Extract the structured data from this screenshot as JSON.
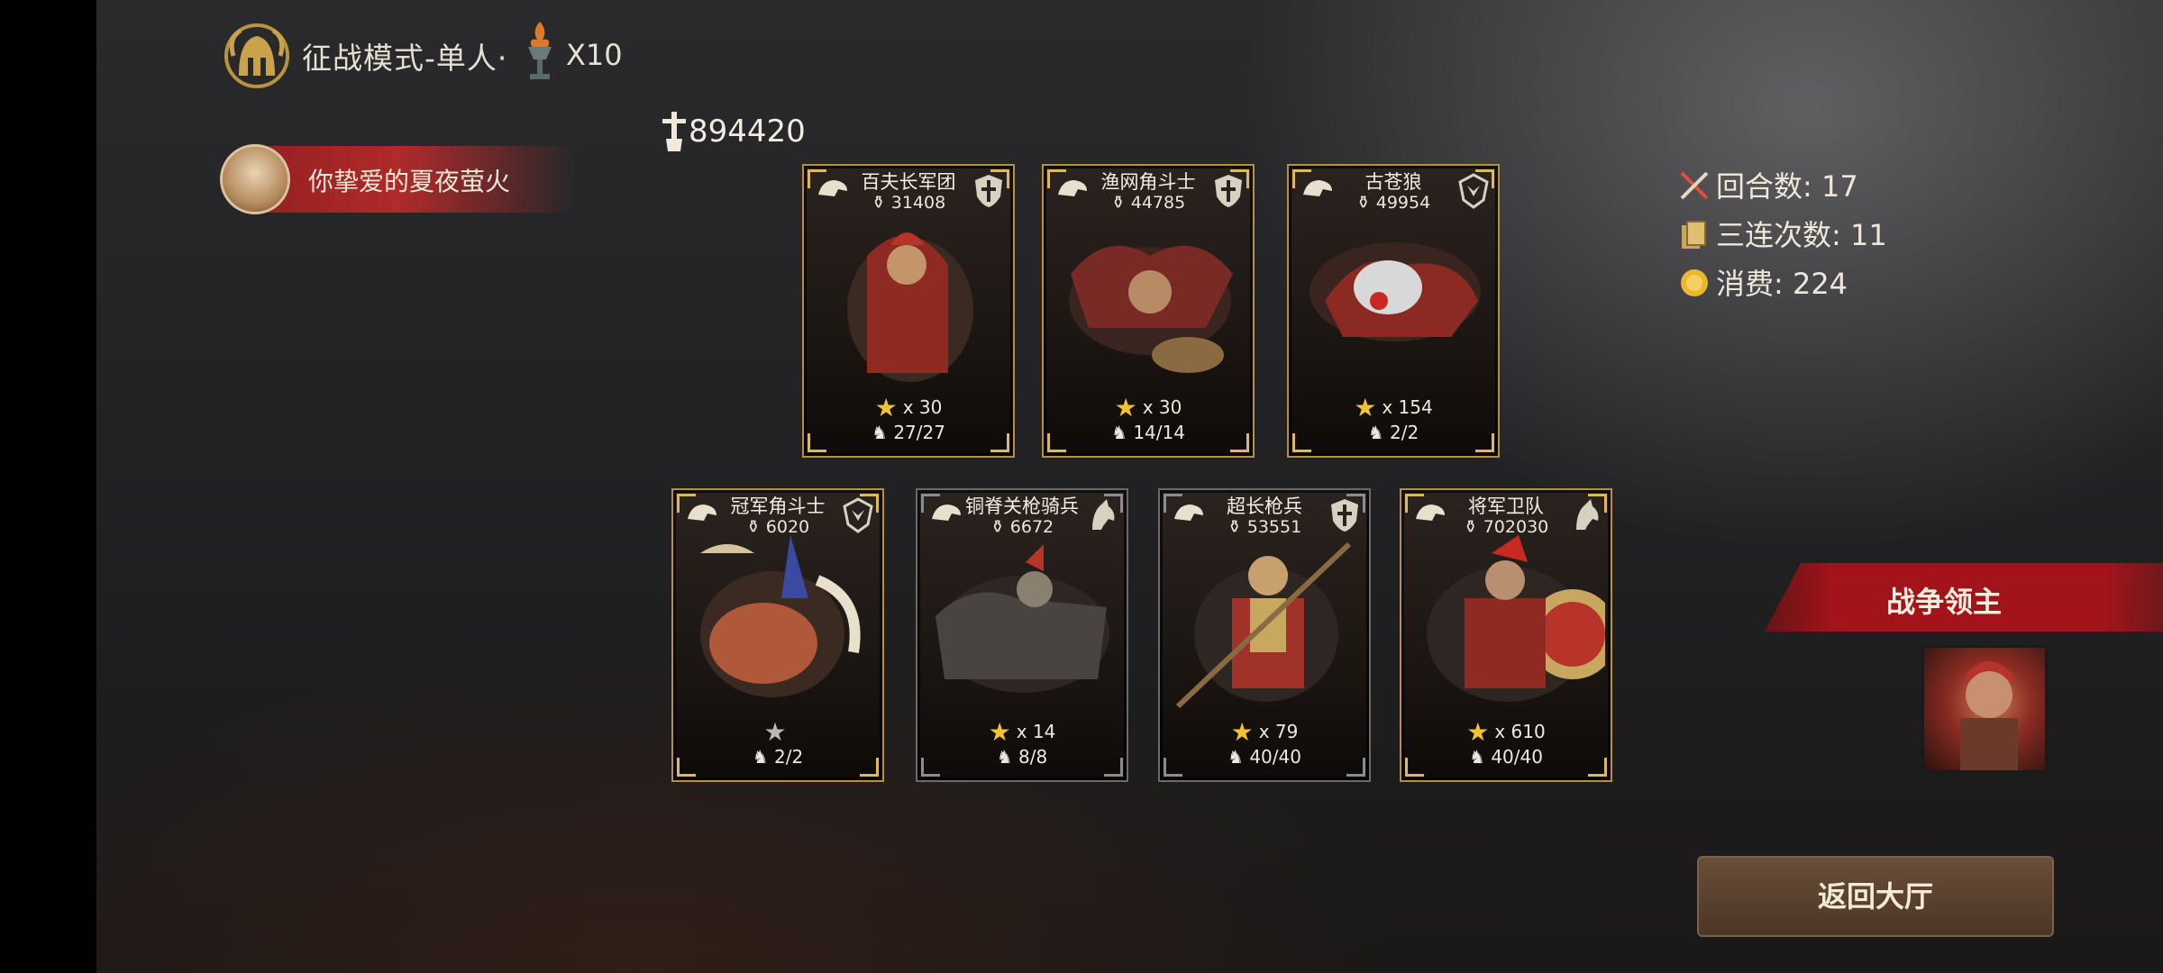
{
  "header": {
    "mode_title": "征战模式-单人·",
    "multiplier": "X10"
  },
  "player": {
    "name": "你挚爱的夏夜萤火"
  },
  "total_power": "894420",
  "cards_top": [
    {
      "name": "百夫长军团",
      "power": "31408",
      "stars": "x 30",
      "count": "27/27",
      "frame": "gold",
      "type_icon": "shield-icon"
    },
    {
      "name": "渔网角斗士",
      "power": "44785",
      "stars": "x 30",
      "count": "14/14",
      "frame": "gold",
      "type_icon": "shield-icon"
    },
    {
      "name": "古苍狼",
      "power": "49954",
      "stars": "x 154",
      "count": "2/2",
      "frame": "gold",
      "type_icon": "wolf-crest-icon"
    }
  ],
  "cards_bottom": [
    {
      "name": "冠军角斗士",
      "power": "6020",
      "stars": "",
      "count": "2/2",
      "frame": "gold",
      "type_icon": "wolf-crest-icon"
    },
    {
      "name": "铜脊关枪骑兵",
      "power": "6672",
      "stars": "x 14",
      "count": "8/8",
      "frame": "silver",
      "type_icon": "horse-icon"
    },
    {
      "name": "超长枪兵",
      "power": "53551",
      "stars": "x 79",
      "count": "40/40",
      "frame": "silver",
      "type_icon": "shield-icon"
    },
    {
      "name": "将军卫队",
      "power": "702030",
      "stars": "x 610",
      "count": "40/40",
      "frame": "gold",
      "type_icon": "horse-icon"
    }
  ],
  "stats": {
    "rounds": "回合数: 17",
    "triple_streak": "三连次数: 11",
    "cost": "消费: 224"
  },
  "war_lord": {
    "title": "战争领主"
  },
  "return_button": "返回大厅",
  "colors": {
    "gold_frame": "#b88f3c",
    "silver_frame": "#6a6a6a",
    "banner_red": "#a3141a",
    "star_gold": "#f2c230"
  }
}
